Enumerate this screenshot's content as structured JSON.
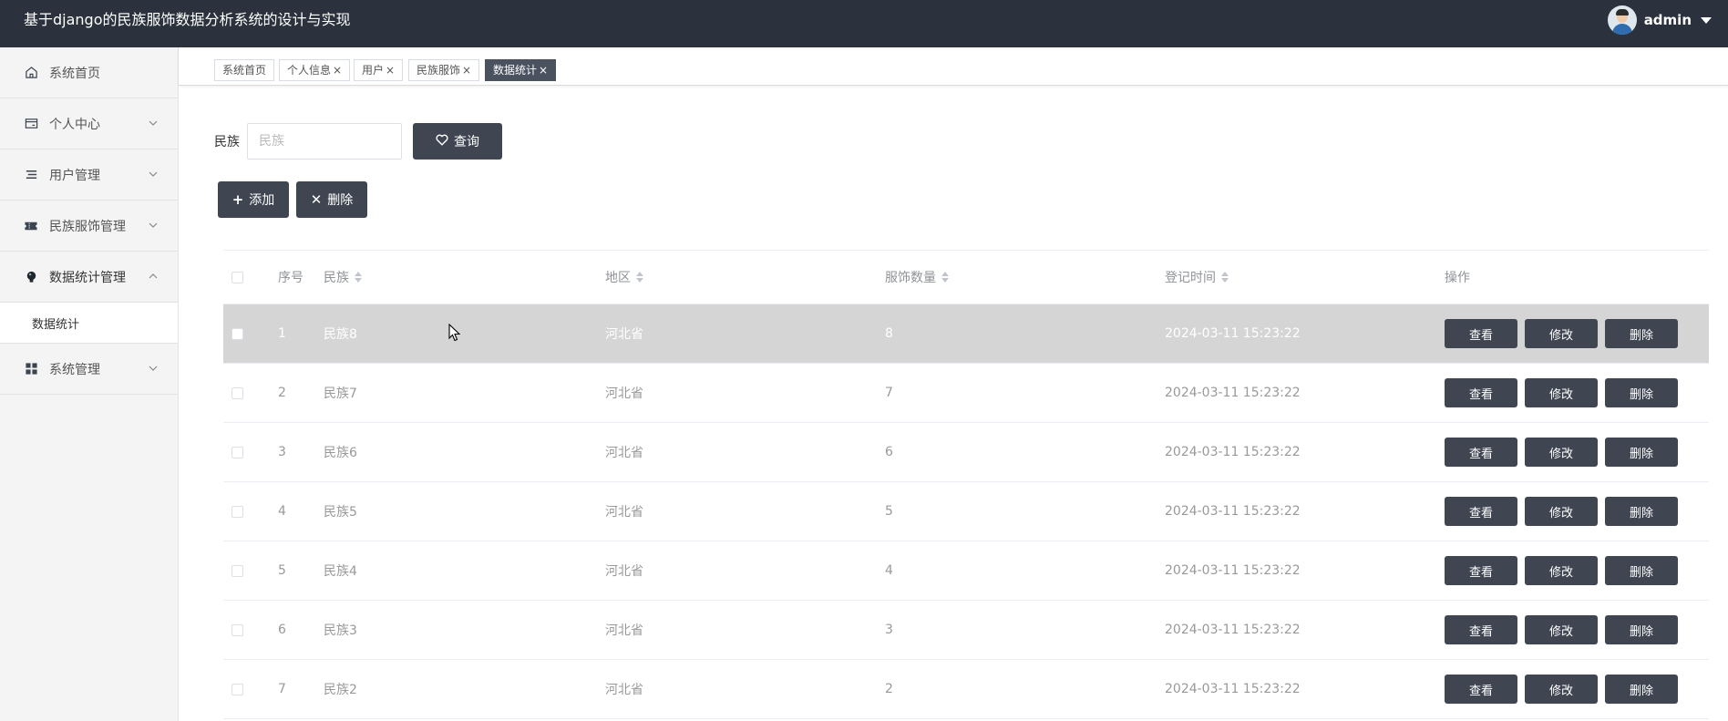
{
  "app_title": "基于django的民族服饰数据分析系统的设计与实现",
  "user": {
    "name": "admin"
  },
  "sidebar": {
    "items": [
      {
        "label": "系统首页",
        "icon": "home-icon",
        "chevron": false
      },
      {
        "label": "个人中心",
        "icon": "card-icon",
        "chevron": true
      },
      {
        "label": "用户管理",
        "icon": "list-icon",
        "chevron": true
      },
      {
        "label": "民族服饰管理",
        "icon": "ticket-icon",
        "chevron": true
      },
      {
        "label": "数据统计管理",
        "icon": "bulb-icon",
        "chevron": true,
        "expanded": true
      },
      {
        "label": "系统管理",
        "icon": "grid-icon",
        "chevron": true
      }
    ],
    "submenu": {
      "label": "数据统计"
    }
  },
  "tabs": [
    {
      "label": "系统首页",
      "closable": false
    },
    {
      "label": "个人信息",
      "closable": true
    },
    {
      "label": "用户",
      "closable": true
    },
    {
      "label": "民族服饰",
      "closable": true
    },
    {
      "label": "数据统计",
      "closable": true,
      "active": true
    }
  ],
  "search": {
    "label": "民族",
    "placeholder": "民族",
    "button": "查询"
  },
  "actions": {
    "add": "添加",
    "delete": "删除"
  },
  "table": {
    "headers": {
      "index": "序号",
      "name": "民族",
      "region": "地区",
      "count": "服饰数量",
      "time": "登记时间",
      "ops": "操作"
    },
    "op_labels": {
      "view": "查看",
      "edit": "修改",
      "delete": "删除"
    },
    "rows": [
      {
        "index": "1",
        "name": "民族8",
        "region": "河北省",
        "count": "8",
        "time": "2024-03-11 15:23:22"
      },
      {
        "index": "2",
        "name": "民族7",
        "region": "河北省",
        "count": "7",
        "time": "2024-03-11 15:23:22"
      },
      {
        "index": "3",
        "name": "民族6",
        "region": "河北省",
        "count": "6",
        "time": "2024-03-11 15:23:22"
      },
      {
        "index": "4",
        "name": "民族5",
        "region": "河北省",
        "count": "5",
        "time": "2024-03-11 15:23:22"
      },
      {
        "index": "5",
        "name": "民族4",
        "region": "河北省",
        "count": "4",
        "time": "2024-03-11 15:23:22"
      },
      {
        "index": "6",
        "name": "民族3",
        "region": "河北省",
        "count": "3",
        "time": "2024-03-11 15:23:22"
      },
      {
        "index": "7",
        "name": "民族2",
        "region": "河北省",
        "count": "2",
        "time": "2024-03-11 15:23:22"
      }
    ]
  },
  "colors": {
    "topbar": "#2b323d",
    "button": "#3f4652",
    "hover_row": "#d5d5d5"
  }
}
